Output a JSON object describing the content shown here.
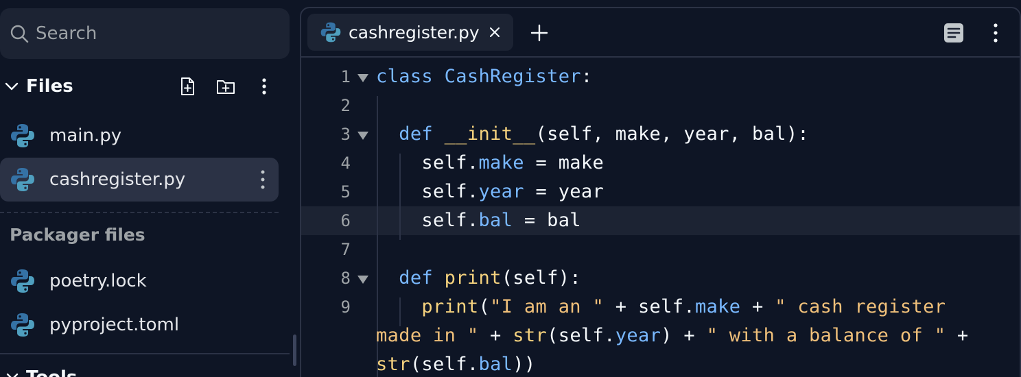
{
  "search": {
    "placeholder": "Search"
  },
  "files_section": {
    "title": "Files"
  },
  "files": [
    {
      "name": "main.py"
    },
    {
      "name": "cashregister.py"
    }
  ],
  "packager_section": {
    "title": "Packager files"
  },
  "packager_files": [
    {
      "name": "poetry.lock"
    },
    {
      "name": "pyproject.toml"
    }
  ],
  "tools_section": {
    "title": "Tools"
  },
  "editor": {
    "tab_label": "cashregister.py",
    "current_line": 6,
    "line_numbers": [
      "1",
      "2",
      "3",
      "4",
      "5",
      "6",
      "7",
      "8",
      "9"
    ]
  },
  "colors": {
    "background": "#0e1525",
    "panel": "#1c2333",
    "active": "#2b3245",
    "keyword": "#79b8ff",
    "function": "#f5d27e",
    "string": "#f0c07a",
    "python_blue": "#3572a5",
    "python_teal": "#4f9fbf"
  },
  "icons": [
    "search-icon",
    "chevron-down-icon",
    "new-file-icon",
    "new-folder-icon",
    "more-vertical-icon",
    "python-icon",
    "close-icon",
    "plus-icon",
    "layout-icon"
  ]
}
